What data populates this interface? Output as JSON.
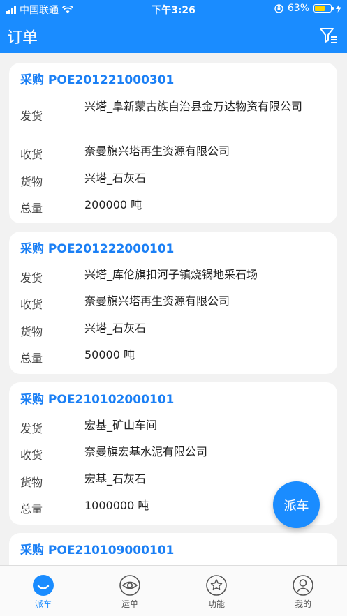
{
  "status_bar": {
    "carrier": "中国联通",
    "time": "下午3:26",
    "battery": "63%",
    "battery_level": 0.63
  },
  "header": {
    "title": "订单",
    "filter_icon": "filter-icon"
  },
  "orders": [
    {
      "title": "采购 POE201221000301",
      "rows": [
        {
          "label": "发货",
          "value": "兴塔_阜新蒙古族自治县金万达物资有限公司"
        },
        {
          "label": "收货",
          "value": "奈曼旗兴塔再生资源有限公司"
        },
        {
          "label": "货物",
          "value": "兴塔_石灰石"
        },
        {
          "label": "总量",
          "value": "200000 吨"
        }
      ]
    },
    {
      "title": "采购 POE201222000101",
      "rows": [
        {
          "label": "发货",
          "value": "兴塔_库伦旗扣河子镇烧锅地采石场"
        },
        {
          "label": "收货",
          "value": "奈曼旗兴塔再生资源有限公司"
        },
        {
          "label": "货物",
          "value": "兴塔_石灰石"
        },
        {
          "label": "总量",
          "value": "50000 吨"
        }
      ]
    },
    {
      "title": "采购 POE210102000101",
      "rows": [
        {
          "label": "发货",
          "value": "宏基_矿山车间"
        },
        {
          "label": "收货",
          "value": "奈曼旗宏基水泥有限公司"
        },
        {
          "label": "货物",
          "value": "宏基_石灰石"
        },
        {
          "label": "总量",
          "value": "1000000 吨"
        }
      ]
    },
    {
      "title": "采购 POE210109000101",
      "rows": []
    }
  ],
  "fab": {
    "label": "派车"
  },
  "tabs": [
    {
      "label": "派车",
      "icon": "dispatch-icon",
      "active": true
    },
    {
      "label": "运单",
      "icon": "eye-icon",
      "active": false
    },
    {
      "label": "功能",
      "icon": "function-icon",
      "active": false
    },
    {
      "label": "我的",
      "icon": "profile-icon",
      "active": false
    }
  ],
  "colors": {
    "primary": "#1a8cff",
    "title_blue": "#1a7ff5",
    "background": "#f2f2f2"
  }
}
